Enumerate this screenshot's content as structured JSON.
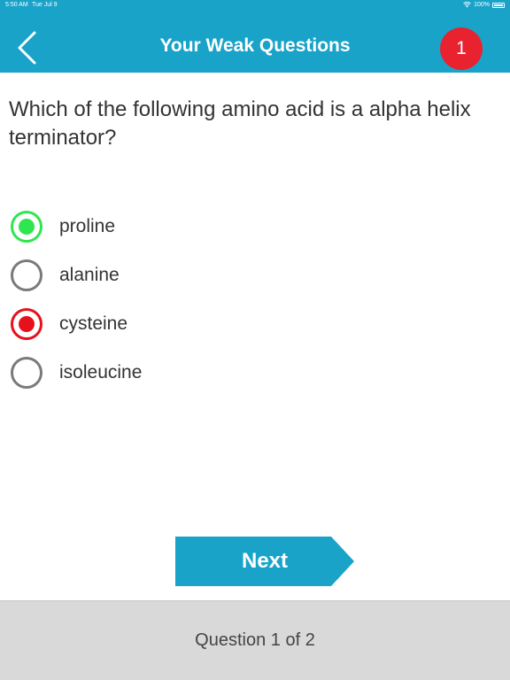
{
  "status_bar": {
    "time": "5:50 AM",
    "date": "Tue Jul 9",
    "battery": "100%",
    "wifi_icon": "wifi-icon",
    "battery_icon": "battery-icon"
  },
  "header": {
    "title": "Your Weak Questions",
    "back_icon": "chevron-left-icon",
    "badge_count": "1",
    "background_color": "#1aa3c9",
    "badge_color": "#e8222e"
  },
  "question": {
    "text": "Which of the following amino acid is a alpha helix terminator?"
  },
  "options": [
    {
      "label": "proline",
      "state": "correct"
    },
    {
      "label": "alanine",
      "state": "unselected"
    },
    {
      "label": "cysteine",
      "state": "wrong"
    },
    {
      "label": "isoleucine",
      "state": "unselected"
    }
  ],
  "colors": {
    "correct": "#2ee64f",
    "wrong": "#e8101c",
    "neutral": "#7a7a7a"
  },
  "next_button": {
    "label": "Next",
    "color": "#1aa3c9"
  },
  "footer": {
    "progress_text": "Question 1 of 2"
  }
}
